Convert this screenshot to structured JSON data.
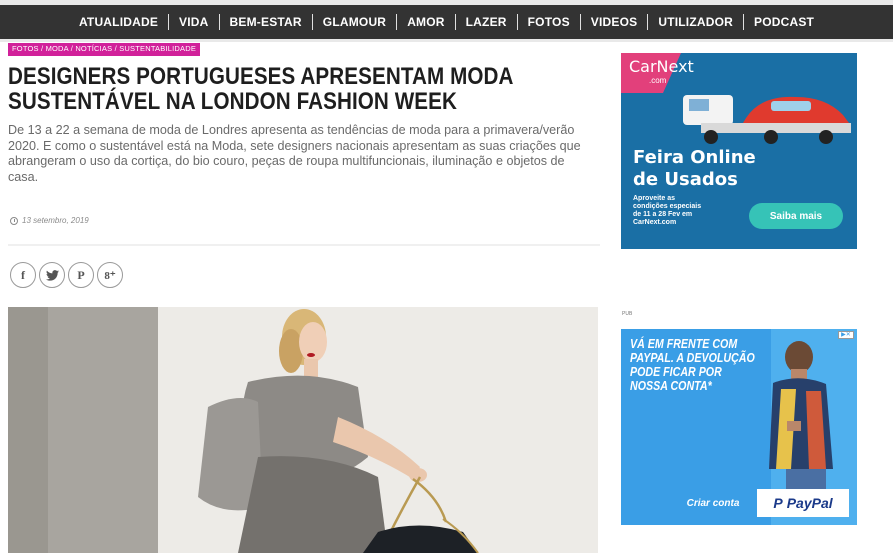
{
  "nav": {
    "items": [
      "ATUALIDADE",
      "VIDA",
      "BEM-ESTAR",
      "GLAMOUR",
      "AMOR",
      "LAZER",
      "FOTOS",
      "VIDEOS",
      "UTILIZADOR",
      "PODCAST"
    ]
  },
  "article": {
    "categories": [
      "FOTOS",
      "MODA",
      "NOTÍCIAS",
      "SUSTENTABILIDADE"
    ],
    "category_separator": " / ",
    "title": "DESIGNERS PORTUGUESES APRESENTAM MODA SUSTENTÁVEL NA LONDON FASHION WEEK",
    "lead": "De 13 a 22 a semana de moda de Londres apresenta as tendências de moda para a primavera/verão 2020. E como o sustentável está na Moda, sete designers nacionais apresentam as suas criações que abrangeram o uso da cortiça, do bio couro, peças de roupa multifuncionais, iluminação e objetos de casa.",
    "date": "13 setembro, 2019"
  },
  "share": {
    "facebook": "f",
    "twitter": "🐦",
    "pinterest": "P",
    "googleplus": "8⁺"
  },
  "ads": {
    "carnext": {
      "logo": "CarNext",
      "logo_sub": ".com",
      "headline_1": "Feira Online",
      "headline_2": "de Usados",
      "body_1": "Aproveite as",
      "body_2": "condições especiais",
      "body_3": "de 11 a 28 Fev em",
      "body_4": "CarNext.com",
      "cta": "Saiba mais",
      "bg": "#1a6fa5",
      "cta_color": "#36c3b7"
    },
    "label": "PUB",
    "paypal": {
      "text_1": "VÁ EM FRENTE COM",
      "text_2": "PAYPAL. A DEVOLUÇÃO",
      "text_3": "PODE FICAR POR",
      "text_4": "NOSSA CONTA*",
      "cta": "Criar conta",
      "brand": "PayPal",
      "bg": "#2d8fd6"
    }
  }
}
